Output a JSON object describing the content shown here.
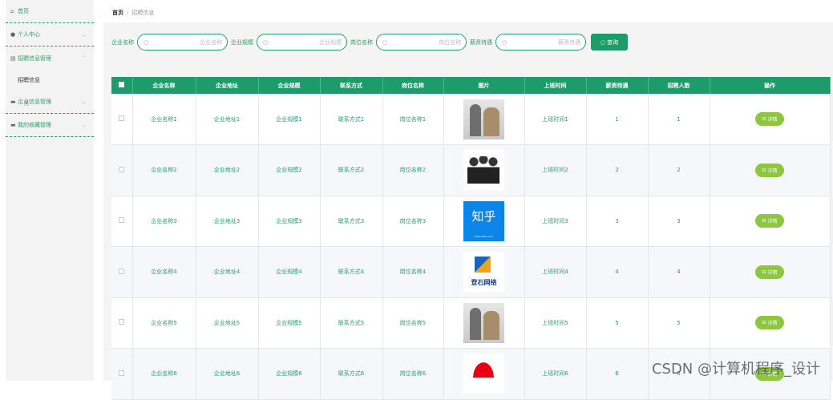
{
  "sidebar": {
    "items": [
      {
        "icon": "home-icon",
        "glyph": "⌂",
        "label": "首页",
        "chev": ""
      },
      {
        "icon": "user-icon",
        "glyph": "👤",
        "label": "个人中心",
        "chev": "⌄"
      },
      {
        "icon": "document-icon",
        "glyph": "▤",
        "label": "招聘信息管理",
        "chev": "⌃"
      },
      {
        "icon": "folder-icon",
        "glyph": "▬",
        "label": "企业信息管理",
        "chev": "⌄"
      },
      {
        "icon": "folder-icon",
        "glyph": "▬",
        "label": "我的收藏管理",
        "chev": "⌄"
      }
    ],
    "submenu": {
      "label": "招聘信息"
    }
  },
  "breadcrumb": {
    "home": "首页",
    "separator": "/",
    "current": "招聘信息"
  },
  "search": {
    "fields": [
      {
        "label": "企业名称",
        "placeholder": "企业名称"
      },
      {
        "label": "企业规模",
        "placeholder": "企业规模"
      },
      {
        "label": "岗位名称",
        "placeholder": "岗位名称"
      },
      {
        "label": "薪资待遇",
        "placeholder": "薪资待遇"
      }
    ],
    "button_label": "查询"
  },
  "table": {
    "headers": [
      "企业名称",
      "企业地址",
      "企业规模",
      "联系方式",
      "岗位名称",
      "图片",
      "上班时间",
      "薪资待遇",
      "招聘人数",
      "操作"
    ],
    "detail_label": "详情",
    "rows": [
      {
        "company": "企业名称1",
        "address": "企业地址1",
        "scale": "企业规模1",
        "contact": "联系方式1",
        "position": "岗位名称1",
        "image": "office-photo",
        "worktime": "上班时间1",
        "salary": "1",
        "count": "1"
      },
      {
        "company": "企业名称2",
        "address": "企业地址2",
        "scale": "企业规模2",
        "contact": "联系方式2",
        "position": "岗位名称2",
        "image": "team-photo",
        "worktime": "上班时间2",
        "salary": "2",
        "count": "2"
      },
      {
        "company": "企业名称3",
        "address": "企业地址3",
        "scale": "企业规模3",
        "contact": "联系方式3",
        "position": "岗位名称3",
        "image": "zhihu-logo",
        "worktime": "上班时间3",
        "salary": "3",
        "count": "3"
      },
      {
        "company": "企业名称4",
        "address": "企业地址4",
        "scale": "企业规模4",
        "contact": "联系方式4",
        "position": "岗位名称4",
        "image": "company-logo",
        "worktime": "上班时间4",
        "salary": "4",
        "count": "4"
      },
      {
        "company": "企业名称5",
        "address": "企业地址5",
        "scale": "企业规模5",
        "contact": "联系方式5",
        "position": "岗位名称5",
        "image": "office-photo",
        "worktime": "上班时间5",
        "salary": "5",
        "count": "5"
      },
      {
        "company": "企业名称6",
        "address": "企业地址6",
        "scale": "企业规模6",
        "contact": "联系方式6",
        "position": "岗位名称6",
        "image": "huawei-logo",
        "worktime": "上班时间6",
        "salary": "6",
        "count": "6"
      }
    ]
  },
  "image_text": {
    "zhihu": "知乎",
    "zhihu_url": "www.zhihu.com",
    "logo_text": "登石网络"
  },
  "watermark": "CSDN @计算机程序_设计",
  "colors": {
    "accent": "#1e9b6a",
    "link": "#2a9d6f",
    "detail": "#8dc63f"
  }
}
